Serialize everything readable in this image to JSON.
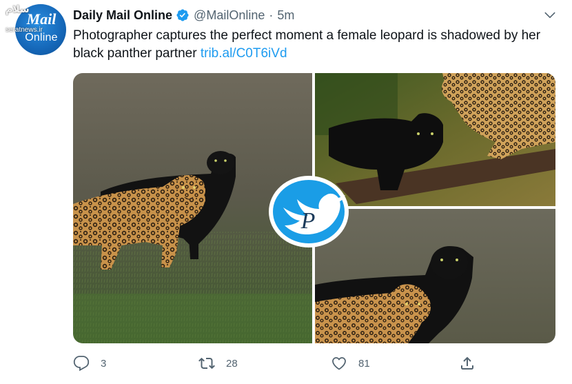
{
  "watermark": {
    "top": "سلام",
    "site": "seratnews.ir"
  },
  "account": {
    "avatar_text_1": "Mail",
    "avatar_text_2": "Online",
    "name": "Daily Mail Online",
    "handle": "@MailOnline",
    "separator": "·",
    "time": "5m",
    "verified_icon": "verified-badge-icon"
  },
  "tweet": {
    "text": "Photographer captures the perfect moment a female leopard is shadowed by her black panther partner",
    "link": "trib.al/C0T6iVd"
  },
  "media": {
    "photos": [
      {
        "description": "leopard-and-black-panther-in-grass"
      },
      {
        "description": "black-panther-under-leopard-on-branch"
      },
      {
        "description": "leopard-in-front-of-black-panther"
      }
    ],
    "overlay_logo": "bird-p-logo"
  },
  "actions": {
    "reply_count": "3",
    "retweet_count": "28",
    "like_count": "81"
  },
  "colors": {
    "text": "#0f1419",
    "secondary": "#536471",
    "link": "#1d9bf0",
    "verified": "#1d9bf0",
    "logo_blue": "#1a9de6"
  }
}
